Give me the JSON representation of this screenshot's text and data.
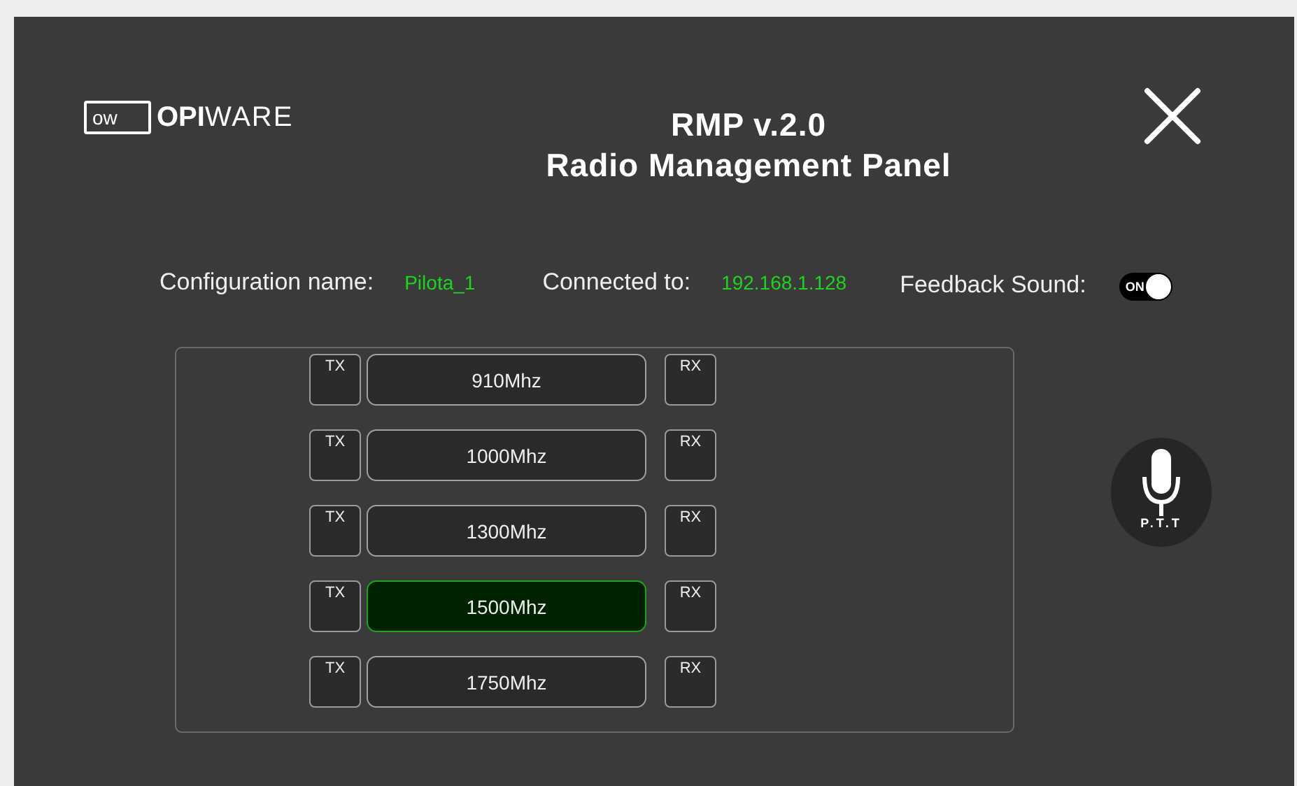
{
  "logo": {
    "box_text": "ow",
    "bold": "OPI",
    "light": "WARE"
  },
  "title": {
    "line1": "RMP v.2.0",
    "line2": "Radio Management Panel"
  },
  "info": [
    {
      "label": "Configuration name:",
      "value": "Pilota_1"
    },
    {
      "label": "Connected to:",
      "value": "192.168.1.128"
    }
  ],
  "feedback_sound": {
    "label": "Feedback Sound:",
    "toggle_text": "ON",
    "on": true
  },
  "channels": [
    {
      "tx": "TX",
      "frequency": "910Mhz",
      "rx": "RX",
      "selected": false
    },
    {
      "tx": "TX",
      "frequency": "1000Mhz",
      "rx": "RX",
      "selected": false
    },
    {
      "tx": "TX",
      "frequency": "1300Mhz",
      "rx": "RX",
      "selected": false
    },
    {
      "tx": "TX",
      "frequency": "1500Mhz",
      "rx": "RX",
      "selected": true
    },
    {
      "tx": "TX",
      "frequency": "1750Mhz",
      "rx": "RX",
      "selected": false
    }
  ],
  "ptt": {
    "label": "P.T.T"
  }
}
